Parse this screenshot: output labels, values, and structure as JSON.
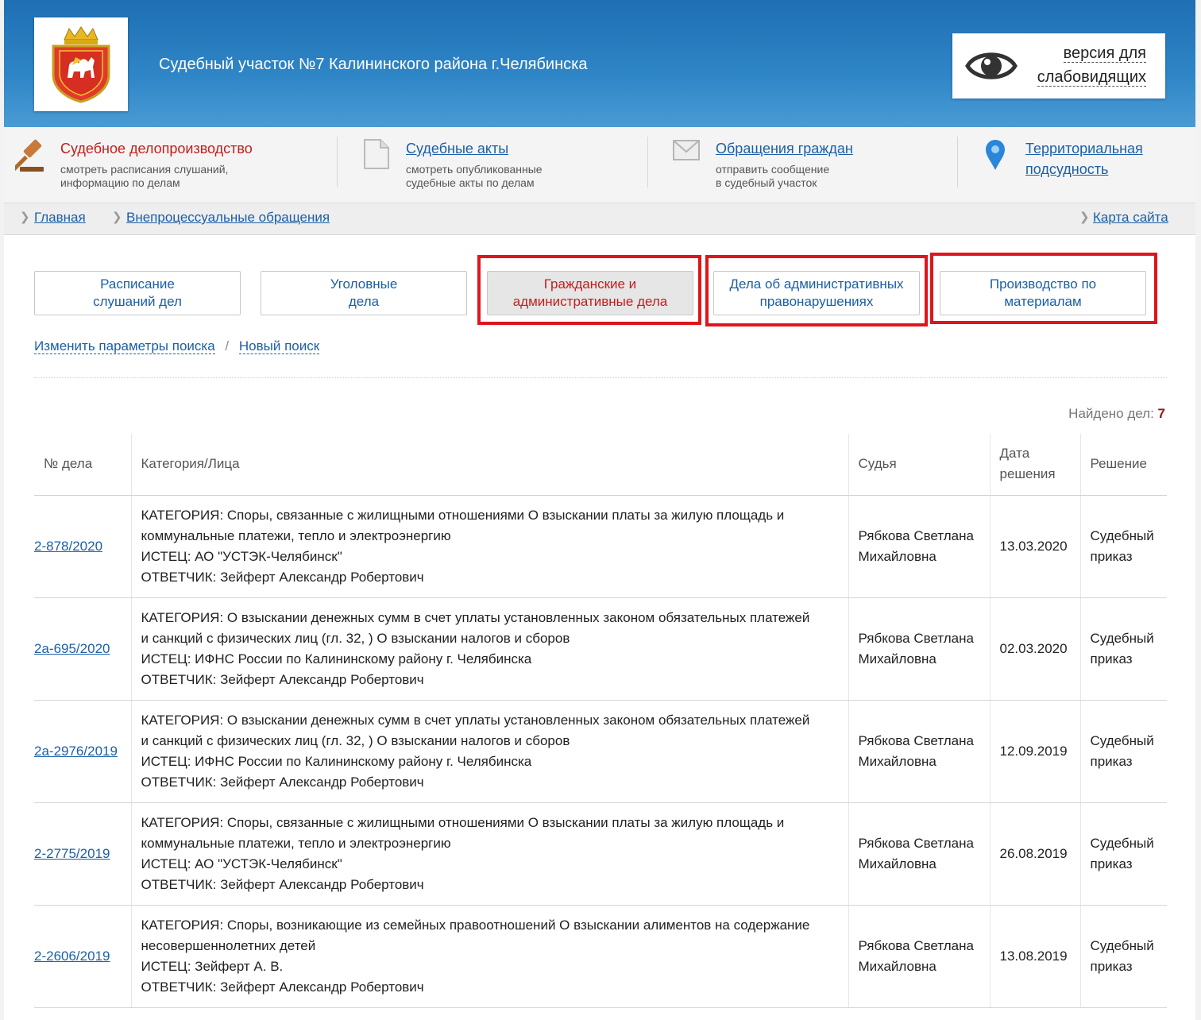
{
  "header": {
    "site_title": "Судебный участок №7 Калининского района г.Челябинска",
    "vision_line1": "версия для",
    "vision_line2": "слабовидящих"
  },
  "nav": [
    {
      "title": "Судебное делопроизводство",
      "desc1": "смотреть расписания слушаний,",
      "desc2": "информацию по делам",
      "icon": "gavel-icon"
    },
    {
      "title": "Судебные акты",
      "desc1": "смотреть опубликованные",
      "desc2": "судебные акты по делам",
      "icon": "document-icon"
    },
    {
      "title": "Обращения граждан",
      "desc1": "отправить сообщение",
      "desc2": "в судебный участок",
      "icon": "envelope-icon"
    },
    {
      "title1": "Территориальная",
      "title2": "подсудность",
      "icon": "map-pin-icon"
    }
  ],
  "breadcrumb": {
    "home": "Главная",
    "current": "Внепроцессуальные обращения",
    "sitemap": "Карта сайта"
  },
  "tabs": [
    {
      "line1": "Расписание",
      "line2": "слушаний дел"
    },
    {
      "line1": "Уголовные",
      "line2": "дела"
    },
    {
      "line1": "Гражданские и",
      "line2": "административные дела"
    },
    {
      "line1": "Дела об административных",
      "line2": "правонарушениях"
    },
    {
      "line1": "Производство по",
      "line2": "материалам"
    }
  ],
  "search": {
    "change": "Изменить параметры поиска",
    "sep": "/",
    "new": "Новый поиск"
  },
  "found": {
    "label": "Найдено дел:",
    "count": "7"
  },
  "table": {
    "headers": {
      "num": "№ дела",
      "category": "Категория/Лица",
      "judge": "Судья",
      "date1": "Дата",
      "date2": "решения",
      "decision": "Решение"
    },
    "rows": [
      {
        "num": "2-878/2020",
        "c1": "КАТЕГОРИЯ: Споры, связанные с жилищными отношениями О взыскании платы за жилую площадь и",
        "c2": "коммунальные платежи, тепло и электроэнергию",
        "c3": "ИСТЕЦ: АО \"УСТЭК-Челябинск\"",
        "c4": "ОТВЕТЧИК: Зейферт Александр Робертович",
        "judge1": "Рябкова Светлана",
        "judge2": "Михайловна",
        "date": "13.03.2020",
        "dec1": "Судебный",
        "dec2": "приказ"
      },
      {
        "num": "2а-695/2020",
        "c1": "КАТЕГОРИЯ: О взыскании денежных сумм в счет уплаты установленных законом обязательных платежей",
        "c2": "и санкций с физических лиц (гл. 32, ) О взыскании налогов и сборов",
        "c3": "ИСТЕЦ: ИФНС России по Калининскому району г. Челябинска",
        "c4": "ОТВЕТЧИК: Зейферт Александр Робертович",
        "judge1": "Рябкова Светлана",
        "judge2": "Михайловна",
        "date": "02.03.2020",
        "dec1": "Судебный",
        "dec2": "приказ"
      },
      {
        "num": "2а-2976/2019",
        "c1": "КАТЕГОРИЯ: О взыскании денежных сумм в счет уплаты установленных законом обязательных платежей",
        "c2": "и санкций с физических лиц (гл. 32, ) О взыскании налогов и сборов",
        "c3": "ИСТЕЦ: ИФНС России по Калининскому району г. Челябинска",
        "c4": "ОТВЕТЧИК: Зейферт Александр Робертович",
        "judge1": "Рябкова Светлана",
        "judge2": "Михайловна",
        "date": "12.09.2019",
        "dec1": "Судебный",
        "dec2": "приказ"
      },
      {
        "num": "2-2775/2019",
        "c1": "КАТЕГОРИЯ: Споры, связанные с жилищными отношениями О взыскании платы за жилую площадь и",
        "c2": "коммунальные платежи, тепло и электроэнергию",
        "c3": "ИСТЕЦ: АО \"УСТЭК-Челябинск\"",
        "c4": "ОТВЕТЧИК: Зейферт Александр Робертович",
        "judge1": "Рябкова Светлана",
        "judge2": "Михайловна",
        "date": "26.08.2019",
        "dec1": "Судебный",
        "dec2": "приказ"
      },
      {
        "num": "2-2606/2019",
        "c1": "КАТЕГОРИЯ: Споры, возникающие из семейных правоотношений О взыскании алиментов на содержание",
        "c2": "несовершеннолетних детей",
        "c3": "ИСТЕЦ: Зейферт А. В.",
        "c4": "ОТВЕТЧИК: Зейферт Александр Робертович",
        "judge1": "Рябкова Светлана",
        "judge2": "Михайловна",
        "date": "13.08.2019",
        "dec1": "Судебный",
        "dec2": "приказ"
      }
    ]
  },
  "colors": {
    "header_blue": "#2f86c7",
    "link": "#1a5fa8",
    "active_tab_text": "#c0201c",
    "highlight": "#e0151b"
  }
}
